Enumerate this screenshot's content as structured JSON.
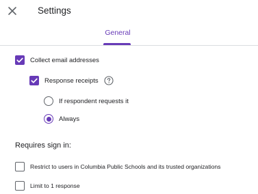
{
  "header": {
    "title": "Settings",
    "close_icon": "close-icon"
  },
  "tabs": [
    {
      "label": "General",
      "active": true
    }
  ],
  "options": {
    "collect_email": {
      "label": "Collect email addresses",
      "checked": true
    },
    "response_receipts": {
      "label": "Response receipts",
      "checked": true,
      "help_icon": "help-circle-icon"
    },
    "receipt_choices": [
      {
        "label": "If respondent requests it",
        "selected": false
      },
      {
        "label": "Always",
        "selected": true
      }
    ]
  },
  "sign_in": {
    "heading": "Requires sign in:",
    "restrict": {
      "label": "Restrict to users in Columbia Public Schools and its trusted organizations",
      "checked": false
    },
    "limit": {
      "label": "Limit to 1 response",
      "checked": false
    }
  },
  "colors": {
    "accent": "#673ab7",
    "text": "#202124",
    "muted": "#5f6368",
    "divider": "#dadce0"
  }
}
